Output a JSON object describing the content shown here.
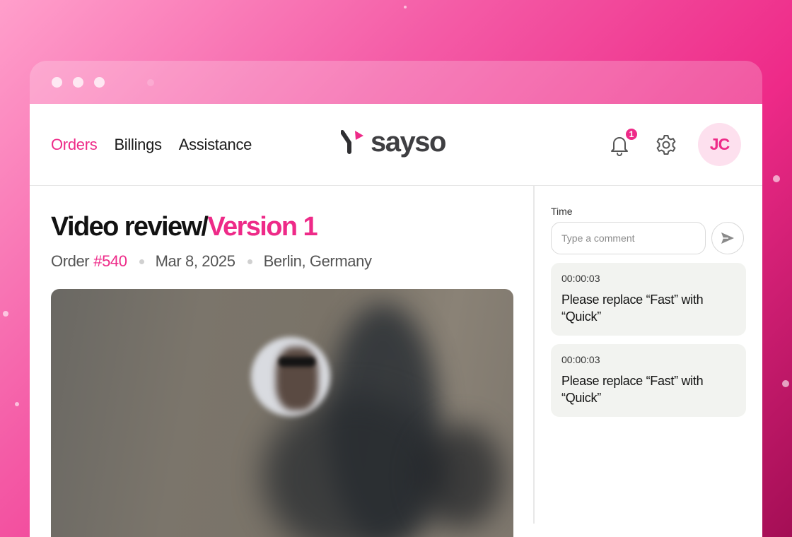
{
  "nav": {
    "links": [
      {
        "label": "Orders",
        "active": true
      },
      {
        "label": "Billings",
        "active": false
      },
      {
        "label": "Assistance",
        "active": false
      }
    ],
    "logo_text": "sayso",
    "notification_count": "1",
    "avatar_initials": "JC"
  },
  "page": {
    "title": "Video review/",
    "version": "Version 1",
    "order_label": "Order",
    "order_number": "#540",
    "date": "Mar 8, 2025",
    "location": "Berlin, Germany"
  },
  "sidebar": {
    "label": "Time",
    "comment_placeholder": "Type a comment",
    "comments": [
      {
        "timestamp": "00:00:03",
        "text": "Please replace “Fast” with “Quick”"
      },
      {
        "timestamp": "00:00:03",
        "text": "Please replace “Fast” with “Quick”"
      }
    ]
  },
  "icons": {
    "bell": "bell-icon",
    "settings": "gear-icon",
    "send": "send-icon",
    "logo": "sayso-logo-icon"
  },
  "colors": {
    "accent": "#ee2a88",
    "avatar_bg": "#fde0ee",
    "card_bg": "#f2f3f0"
  }
}
